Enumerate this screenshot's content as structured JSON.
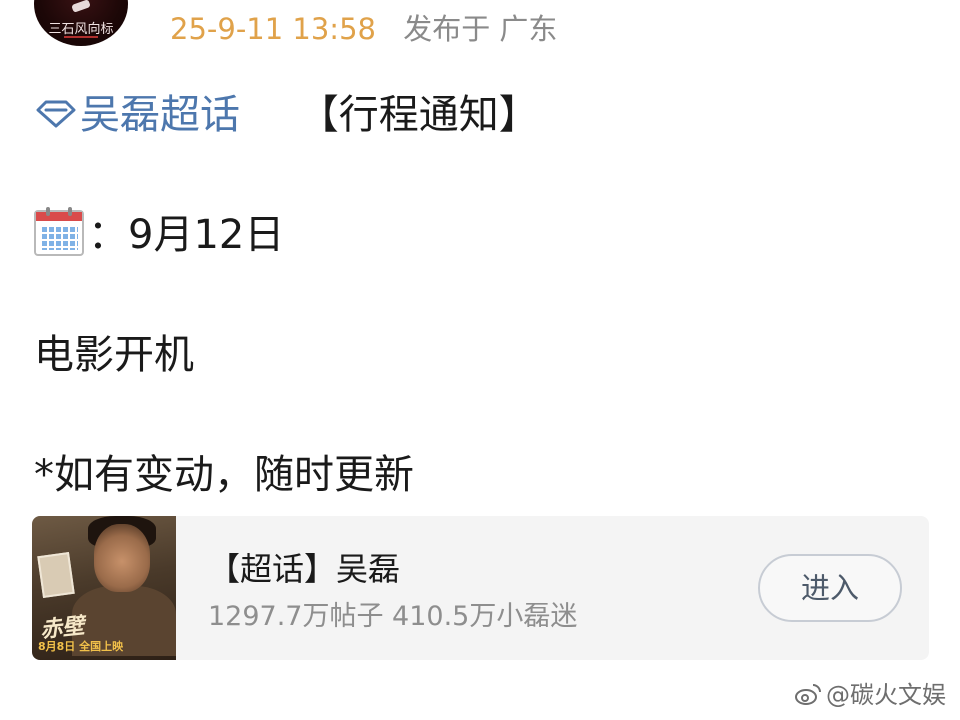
{
  "post": {
    "author_avatar_text": "三石风向标",
    "timestamp": "25-9-11 13:58",
    "location": "发布于 广东"
  },
  "content": {
    "topic_name": "吴磊超话",
    "topic_tag": "【行程通知】",
    "date_line": "：9月12日",
    "event": "电影开机",
    "note": "*如有变动，随时更新"
  },
  "card": {
    "title": "【超话】吴磊",
    "stats": "1297.7万帖子 410.5万小磊迷",
    "enter_label": "进入",
    "poster_date": "8月8日  全国上映"
  },
  "watermark": {
    "text": "@碳火文娱"
  },
  "colors": {
    "timestamp": "#e0a24a",
    "topic_link": "#4d77ad",
    "meta_gray": "#8a8a8a",
    "card_bg": "#f4f4f4"
  },
  "icons": {
    "topic": "super-topic-diamond-icon",
    "date": "calendar-emoji-icon",
    "watermark": "weibo-logo-icon"
  }
}
